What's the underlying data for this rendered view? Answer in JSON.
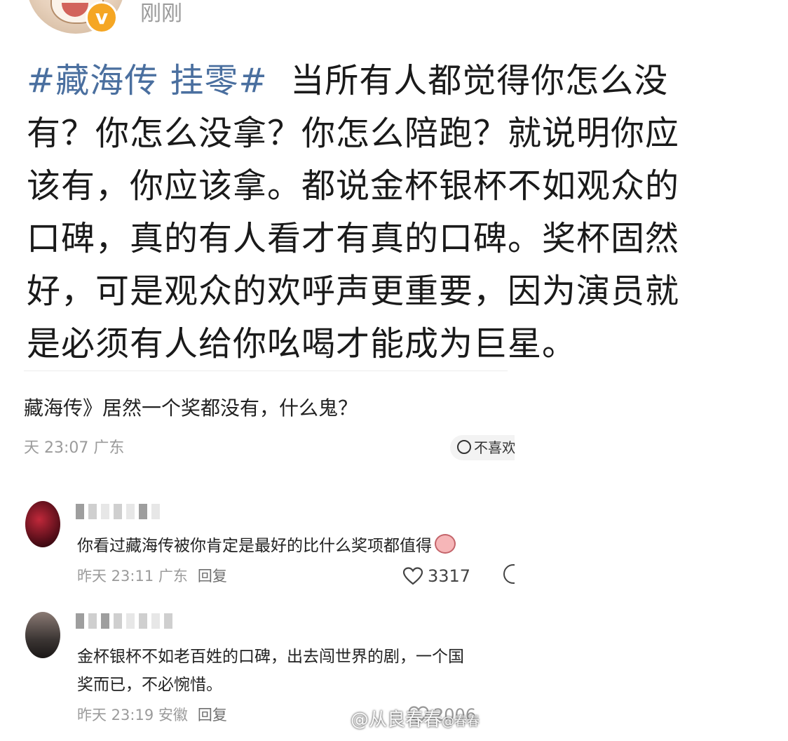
{
  "post": {
    "time": "刚刚",
    "verified_mark": "v",
    "hashtag": "#藏海传 挂零#",
    "lines": [
      "当所有人都觉得你怎么没",
      "有？你怎么没拿？你怎么陪跑？就说明你应",
      "该有，你应该拿。都说金杯银杯不如观众的",
      "口碑，真的有人看才有真的口碑。奖杯固然",
      "好，可是观众的欢呼声更重要，因为演员就",
      "是必须有人给你吆喝才能成为巨星。"
    ]
  },
  "screenshot": {
    "title": "藏海传》居然一个奖都没有，什么鬼？",
    "meta": "天 23:07 广东",
    "dislike_label": "不喜欢",
    "comments": [
      {
        "text": "你看过藏海传被你肯定是最好的比什么奖项都值得",
        "meta": "昨天 23:11 广东",
        "reply": "回复",
        "likes": "3317"
      },
      {
        "text_line1": "金杯银杯不如老百姓的口碑，出去闯世界的剧，一个国",
        "text_line2": "奖而已，不必惋惜。",
        "meta": "昨天 23:19 安徽",
        "reply": "回复",
        "likes": "2006"
      }
    ]
  },
  "watermark": {
    "handle": "@从良春春",
    "small": "@春春"
  },
  "colors": {
    "hashtag": "#4a6f9f",
    "text": "#1a1a1a",
    "meta": "#9b9b9b",
    "badge": "#f5a623"
  }
}
